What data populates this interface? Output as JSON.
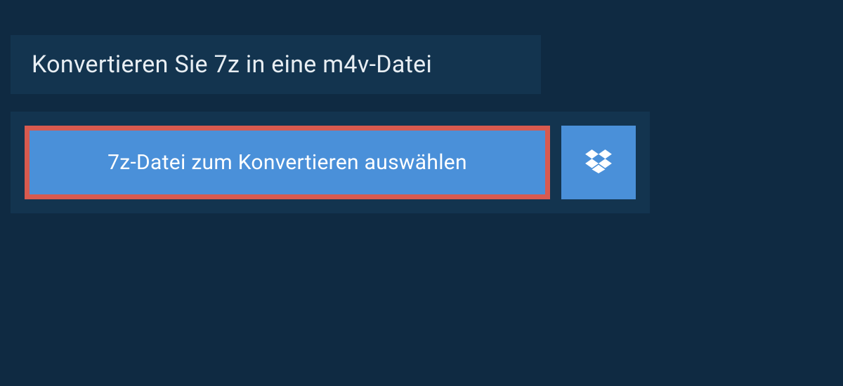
{
  "header": {
    "title": "Konvertieren Sie 7z in eine m4v-Datei"
  },
  "actions": {
    "select_file_label": "7z-Datei zum Konvertieren auswählen"
  },
  "colors": {
    "page_bg": "#0f2a42",
    "panel_bg": "#13344f",
    "button_bg": "#4a90d9",
    "highlight_border": "#d85a4f",
    "text_light": "#e8eef3",
    "text_white": "#ffffff"
  }
}
